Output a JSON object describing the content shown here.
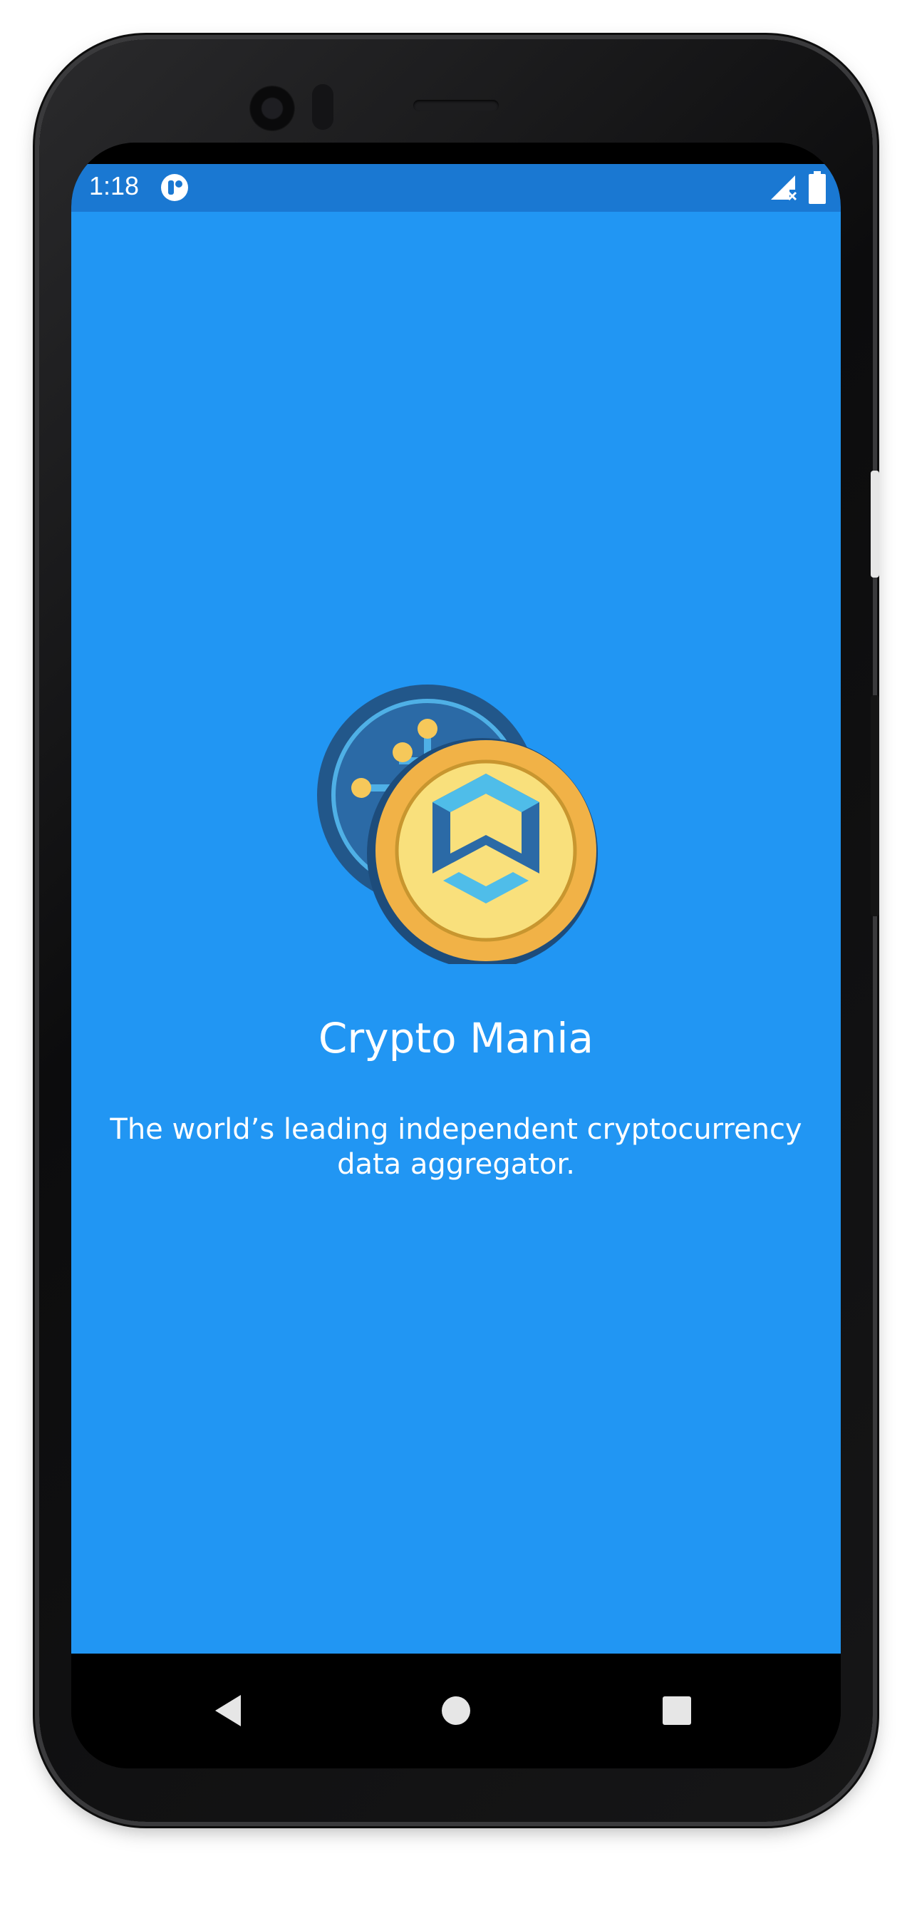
{
  "status_bar": {
    "time": "1:18",
    "icons": [
      "app-notification-icon",
      "signal-no-sim-icon",
      "battery-full-icon"
    ],
    "color": "#1a78d2"
  },
  "splash": {
    "background_color": "#2196f3",
    "logo_icon": "crypto-coins-logo-icon",
    "title": "Crypto Mania",
    "tagline": "The world’s leading independent cryptocurrency data aggregator."
  },
  "nav_bar": {
    "buttons": [
      "back-button",
      "home-button",
      "recents-button"
    ]
  }
}
